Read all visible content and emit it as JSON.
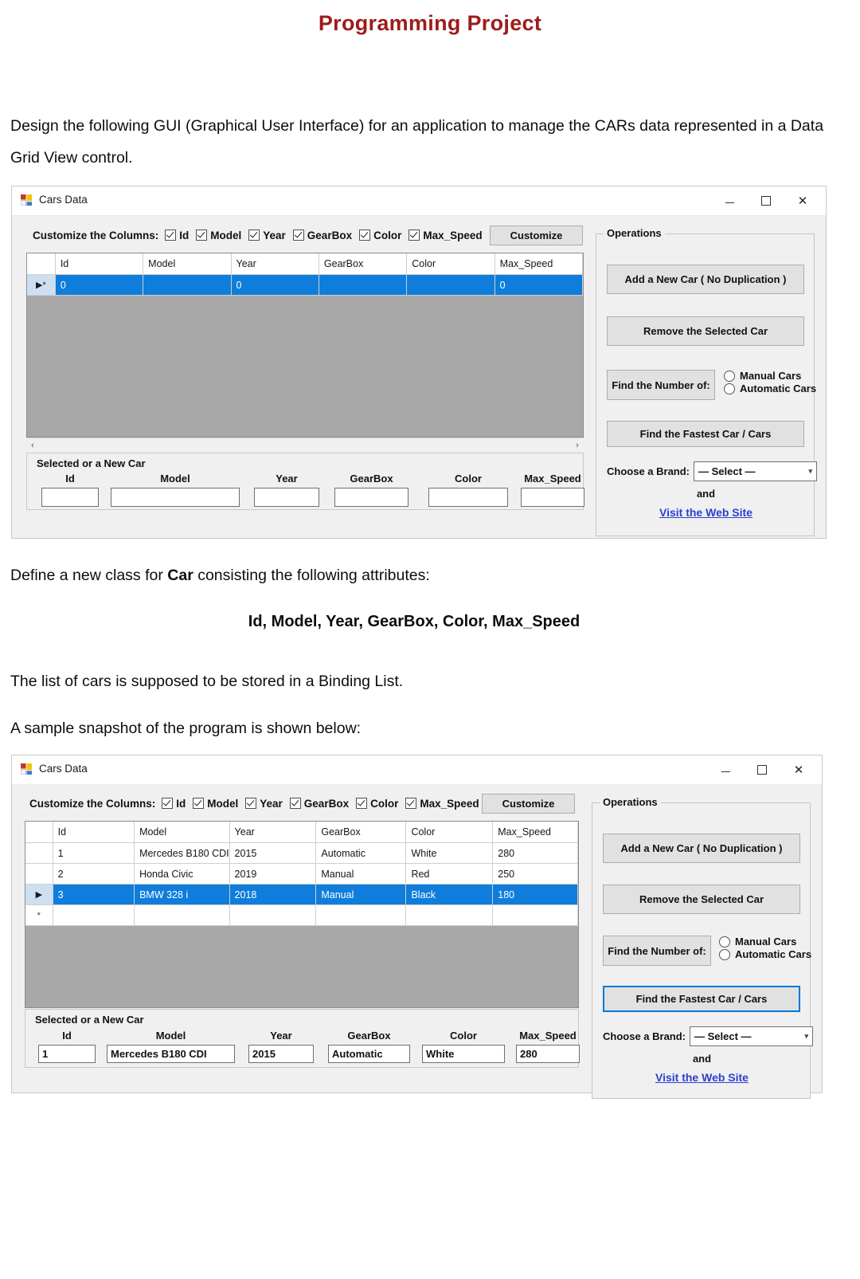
{
  "document": {
    "title": "Programming Project",
    "intro": "Design the following GUI (Graphical User Interface) for an application to manage the CARs data represented in a Data Grid View control.",
    "define_line_pre": "Define a new class for ",
    "define_bold": "Car",
    "define_line_post": " consisting the following attributes:",
    "attributes": "Id, Model, Year, GearBox, Color, Max_Speed",
    "binding": "The list of cars is supposed to be stored in a Binding List.",
    "snapshot": "A sample snapshot of the program is shown below:"
  },
  "colors": {
    "title": "#9e1b1b",
    "selection": "#0f7ddb",
    "focus": "#0078d7",
    "link": "#2b3fd0",
    "grid_empty": "#a8a8a8",
    "form_face": "#f0f0f0"
  },
  "window": {
    "title": "Cars Data",
    "icon": "app-icon",
    "minimize": "–",
    "maximize": "❐",
    "close": "✕"
  },
  "customize": {
    "label": "Customize the Columns:",
    "checkboxes": [
      {
        "label": "Id",
        "checked": true
      },
      {
        "label": "Model",
        "checked": true
      },
      {
        "label": "Year",
        "checked": true
      },
      {
        "label": "GearBox",
        "checked": true
      },
      {
        "label": "Color",
        "checked": true
      },
      {
        "label": "Max_Speed",
        "checked": true
      }
    ],
    "button": "Customize"
  },
  "grid": {
    "columns": [
      "Id",
      "Model",
      "Year",
      "GearBox",
      "Color",
      "Max_Speed"
    ]
  },
  "grid_empty_rows": [
    {
      "marker": "▶*",
      "selected": true,
      "cells": [
        "0",
        "",
        "0",
        "",
        "",
        "0"
      ]
    }
  ],
  "grid_filled_rows": [
    {
      "marker": "",
      "selected": false,
      "cells": [
        "1",
        "Mercedes B180 CDI",
        "2015",
        "Automatic",
        "White",
        "280"
      ]
    },
    {
      "marker": "",
      "selected": false,
      "cells": [
        "2",
        "Honda Civic",
        "2019",
        "Manual",
        "Red",
        "250"
      ]
    },
    {
      "marker": "▶",
      "selected": true,
      "cells": [
        "3",
        "BMW 328 i",
        "2018",
        "Manual",
        "Black",
        "180"
      ]
    },
    {
      "marker": "*",
      "selected": false,
      "cells": [
        "",
        "",
        "",
        "",
        "",
        ""
      ]
    }
  ],
  "scrollbar": {
    "left_arrow": "‹",
    "right_arrow": "›"
  },
  "selected_panel": {
    "title": "Selected or a New Car",
    "labels": [
      "Id",
      "Model",
      "Year",
      "GearBox",
      "Color",
      "Max_Speed"
    ],
    "values_empty": [
      "",
      "",
      "",
      "",
      "",
      ""
    ],
    "values_filled": [
      "1",
      "Mercedes B180 CDI",
      "2015",
      "Automatic",
      "White",
      "280"
    ]
  },
  "operations": {
    "legend": "Operations",
    "add_button": "Add a New Car ( No Duplication )",
    "remove_button": "Remove the Selected Car",
    "find_number_button": "Find the Number of:",
    "radios": [
      {
        "label": "Manual Cars",
        "selected": false
      },
      {
        "label": "Automatic Cars",
        "selected": false
      }
    ],
    "fastest_button": "Find the Fastest Car / Cars",
    "brand_label": "Choose a Brand:",
    "brand_value": "— Select —",
    "brand_chevron": "▾",
    "and_text": "and",
    "web_link": "Visit the Web Site"
  }
}
